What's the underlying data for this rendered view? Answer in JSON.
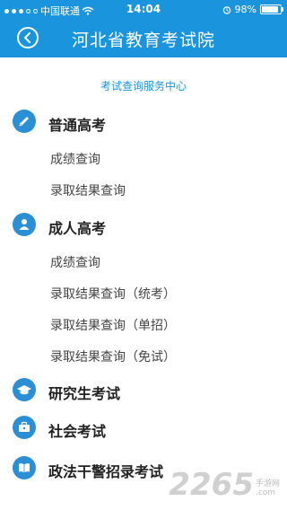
{
  "status": {
    "carrier": "中国联通",
    "time": "14:04",
    "battery": "98%"
  },
  "header": {
    "title": "河北省教育考试院"
  },
  "center_link": "考试查询服务中心",
  "sections": [
    {
      "title": "普通高考",
      "icon": "pencil-icon",
      "items": [
        "成绩查询",
        "录取结果查询"
      ]
    },
    {
      "title": "成人高考",
      "icon": "person-icon",
      "items": [
        "成绩查询",
        "录取结果查询（统考）",
        "录取结果查询（单招）",
        "录取结果查询（免试）"
      ]
    },
    {
      "title": "研究生考试",
      "icon": "graduation-cap-icon",
      "items": []
    },
    {
      "title": "社会考试",
      "icon": "briefcase-icon",
      "items": []
    },
    {
      "title": "政法干警招录考试",
      "icon": "book-icon",
      "items": []
    }
  ],
  "watermark": {
    "number": "2265",
    "cn": "手游网",
    "domain": ".com"
  },
  "colors": {
    "header": "#1b94de",
    "icon_bg": "#2a8fd4",
    "link": "#1b94de"
  }
}
